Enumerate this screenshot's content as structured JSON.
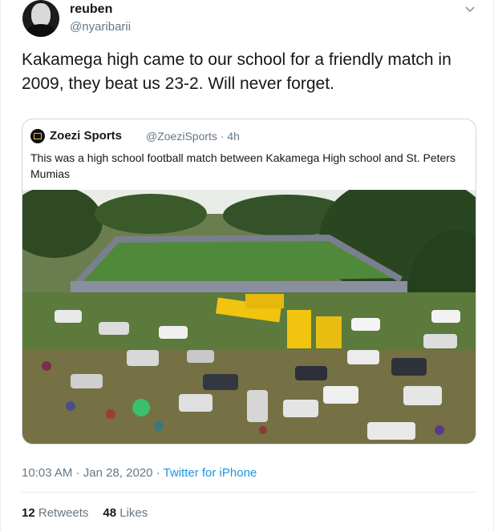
{
  "author": {
    "name": "reuben",
    "handle": "@nyaribarii"
  },
  "tweet": {
    "text": "Kakamega high came to our school for a friendly match in 2009, they beat us 23-2. Will never forget."
  },
  "quoted": {
    "name": "Zoezi Sports",
    "handle": "@ZoeziSports",
    "separator": " · ",
    "time": "4h",
    "text": "This was a high school football match between Kakamega High school and St. Peters Mumias",
    "image_icon": "photo-of-crowded-football-pitch"
  },
  "meta": {
    "time": "10:03 AM",
    "separator1": " · ",
    "date": "Jan 28, 2020",
    "separator2": " · ",
    "source": "Twitter for iPhone"
  },
  "stats": {
    "retweets_count": "12",
    "retweets_label": "Retweets",
    "likes_count": "48",
    "likes_label": "Likes"
  },
  "colors": {
    "link": "#1b95e0",
    "secondary": "#657786",
    "border": "#ccd6dd"
  },
  "icons": [
    "chevron-down-icon",
    "avatar",
    "zoezi-logo-icon"
  ]
}
